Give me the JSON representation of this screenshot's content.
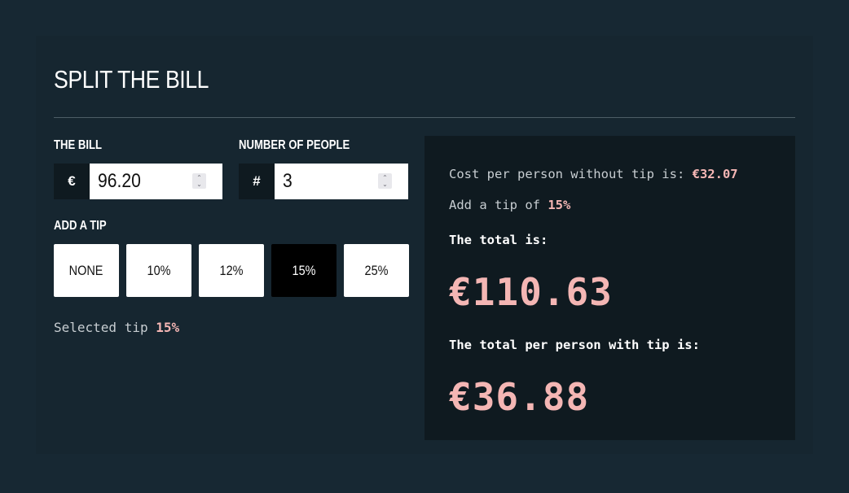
{
  "header": {
    "title": "SPLIT THE BILL"
  },
  "bill": {
    "label": "THE BILL",
    "prefix_icon": "euro-sign",
    "prefix": "€",
    "value": "96.20"
  },
  "people": {
    "label": "NUMBER OF PEOPLE",
    "prefix_icon": "hash-sign",
    "prefix": "#",
    "value": "3"
  },
  "tip": {
    "label": "ADD A TIP",
    "options": [
      {
        "label": "NONE",
        "selected": false
      },
      {
        "label": "10%",
        "selected": false
      },
      {
        "label": "12%",
        "selected": false
      },
      {
        "label": "15%",
        "selected": true
      },
      {
        "label": "25%",
        "selected": false
      }
    ],
    "selected_prefix": "Selected tip",
    "selected_value": "15%"
  },
  "result": {
    "cost_without_tip_prefix": "Cost per person without tip is:",
    "cost_without_tip_value": "€32.07",
    "tip_prefix": "Add a tip of",
    "tip_value": "15%",
    "total_label": "The total is:",
    "total_value": "€110.63",
    "per_person_label": "The total per person with tip is:",
    "per_person_value": "€36.88"
  },
  "colors": {
    "background": "#172833",
    "card": "#162630",
    "result_panel": "#0f1a20",
    "accent": "#f4b6b4",
    "selected_tip_bg": "#000000"
  }
}
